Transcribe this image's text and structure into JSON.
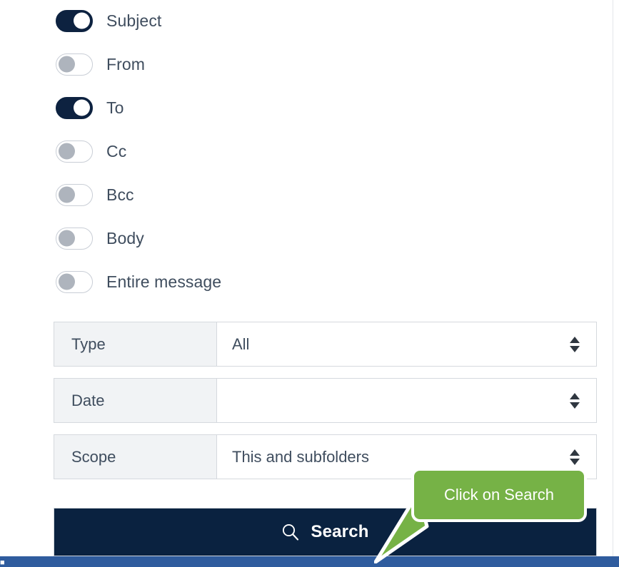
{
  "filters": {
    "toggles": [
      {
        "label": "Subject",
        "state": "on",
        "icon": "toggle-switch-on-icon"
      },
      {
        "label": "From",
        "state": "off",
        "icon": "toggle-switch-off-icon"
      },
      {
        "label": "To",
        "state": "on",
        "icon": "toggle-switch-on-icon"
      },
      {
        "label": "Cc",
        "state": "off",
        "icon": "toggle-switch-off-icon"
      },
      {
        "label": "Bcc",
        "state": "off",
        "icon": "toggle-switch-off-icon"
      },
      {
        "label": "Body",
        "state": "off",
        "icon": "toggle-switch-off-icon"
      },
      {
        "label": "Entire message",
        "state": "off",
        "icon": "toggle-switch-off-icon"
      }
    ],
    "selects": [
      {
        "key": "Type",
        "value": "All"
      },
      {
        "key": "Date",
        "value": ""
      },
      {
        "key": "Scope",
        "value": "This and subfolders"
      }
    ],
    "select_arrow_icon": "select-updown-arrows-icon"
  },
  "search": {
    "label": "Search",
    "icon": "magnifier-icon"
  },
  "callout": {
    "text": "Click on Search"
  },
  "colors": {
    "toggle_on": "#0d2240",
    "toggle_off_knob": "#aeb4bd",
    "search_button_bg": "#0a2240",
    "callout_bg": "#76b246",
    "bottom_bar": "#2f5c9e",
    "label_cell_bg": "#f1f3f5",
    "text": "#3f4d5e"
  }
}
